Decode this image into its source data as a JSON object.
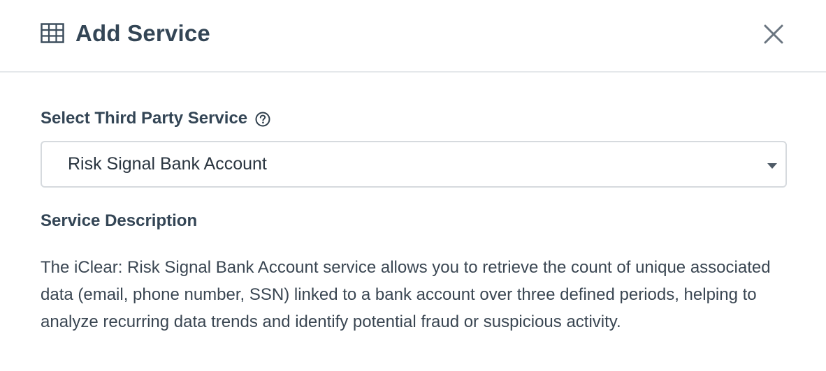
{
  "modal": {
    "title": "Add Service",
    "header_icon": "table-grid-icon",
    "close_icon": "close-icon"
  },
  "service_select": {
    "label": "Select Third Party Service",
    "help_icon": "question-circle-icon",
    "selected_value": "Risk Signal Bank Account",
    "caret_icon": "caret-down-icon"
  },
  "service_description": {
    "label": "Service Description",
    "text": "The iClear: Risk Signal Bank Account service allows you to retrieve the count of unique associated data (email, phone number, SSN) linked to a bank account over three defined periods, helping to analyze recurring data trends and identify potential fraud or suspicious activity."
  },
  "colors": {
    "heading": "#334555",
    "border": "#d6dade",
    "divider": "#e5e8eb",
    "body_text": "#3a4652"
  }
}
